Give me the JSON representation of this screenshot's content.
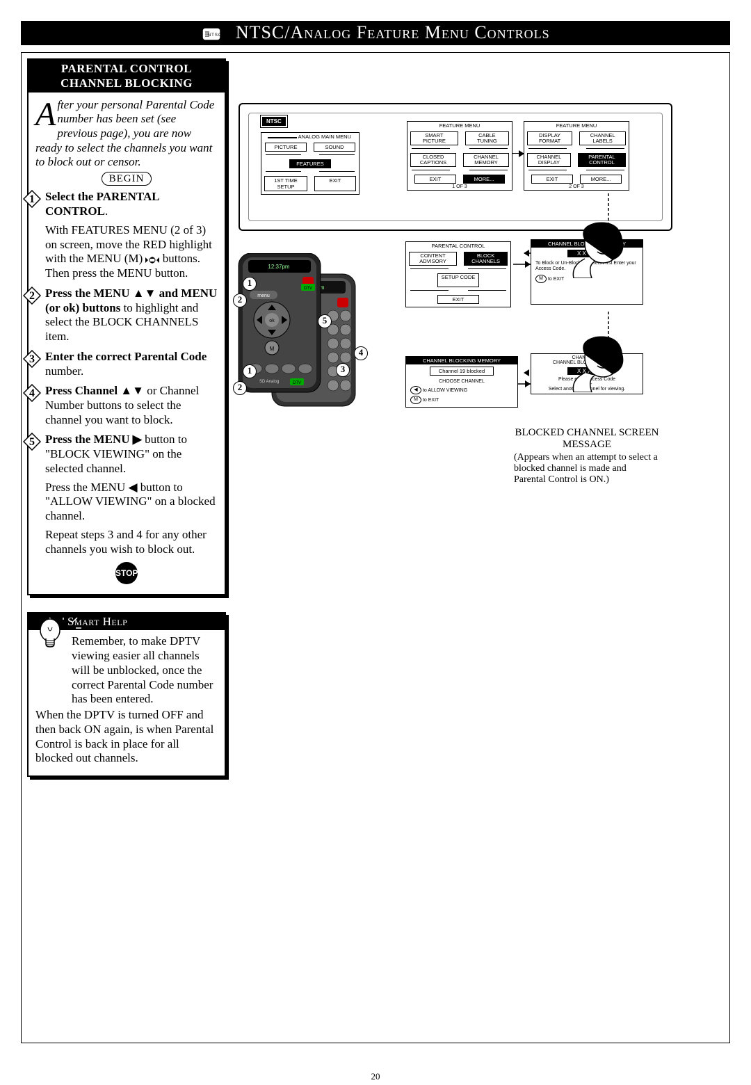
{
  "page_title": "NTSC/Analog Feature Menu Controls",
  "page_number": "20",
  "parental_card": {
    "heading_line1": "PARENTAL CONTROL",
    "heading_line2": "CHANNEL BLOCKING",
    "intro_dropcap": "A",
    "intro_rest": "fter your personal Parental Code number has been set (see previous page), you are now ready to select the channels you want to block out or censor.",
    "begin_label": "BEGIN",
    "step1_bold": "Select the PARENTAL CONTROL",
    "step1_after": ".",
    "step1_detail": "With FEATURES MENU (2 of 3) on screen, move the RED highlight with the MENU (M) ",
    "step1_detail_after": " buttons. Then press the MENU button.",
    "step2_bold": "Press the MENU ▲▼ and MENU (or ok) buttons",
    "step2_rest": " to highlight and select the BLOCK CHANNELS item.",
    "step3_bold": "Enter the correct Parental Code",
    "step3_rest": " number.",
    "step4_bold": "Press Channel ▲▼",
    "step4_rest": " or Channel Number buttons to select the channel you want to block.",
    "step5_bold": "Press the MENU ▶",
    "step5_rest": " button to \"BLOCK VIEWING\" on the selected channel.",
    "step5_line2a": "Press the MENU ◀ button to \"ALLOW VIEWING\" on a blocked channel.",
    "step5_line3": "Repeat steps 3 and 4 for any other channels you wish to block out.",
    "stop_label": "STOP"
  },
  "smart_help": {
    "heading": "Smart Help",
    "para1": "Remember, to make DPTV viewing easier all channels will be unblocked, once the correct Parental Code number has been entered.",
    "para2": "When the DPTV is turned OFF and then back ON again, is when Parental Control is back in place for all blocked out channels."
  },
  "diagram": {
    "ntsc_label": "NTSC",
    "analog_menu": {
      "title": "ANALOG MAIN MENU",
      "btn1": "PICTURE",
      "btn2": "SOUND",
      "btn3": "FEATURES",
      "btn4": "1ST TIME SETUP",
      "btn5": "EXIT"
    },
    "feature_menu_1": {
      "title": "FEATURE MENU",
      "btn1": "SMART PICTURE",
      "btn2": "CABLE TUNING",
      "btn3": "CLOSED CAPTIONS",
      "btn4": "CHANNEL MEMORY",
      "btn5": "EXIT",
      "btn6": "MORE...",
      "footer": "1 OF 3"
    },
    "feature_menu_2": {
      "title": "FEATURE MENU",
      "btn1": "DISPLAY FORMAT",
      "btn2": "CHANNEL LABELS",
      "btn3": "CHANNEL DISPLAY",
      "btn4": "PARENTAL CONTROL",
      "btn5": "EXIT",
      "btn6": "MORE...",
      "footer": "2 OF 3"
    },
    "parental_menu": {
      "title": "PARENTAL CONTROL",
      "btn1": "CONTENT ADVISORY",
      "btn2": "BLOCK CHANNELS",
      "btn3": "SETUP CODE",
      "btn4": "EXIT"
    },
    "cbm1": {
      "title": "CHANNEL BLOCKING MEMORY",
      "code": "X  X  X  X",
      "note": "To Block or Un-Block channels First Enter your Access Code.",
      "exit_key": "M",
      "exit_label": "to EXIT"
    },
    "cbm2": {
      "title": "CHANNEL BLOCKING MEMORY",
      "status": "Channel 19 blocked",
      "choose": "CHOOSE CHANNEL",
      "allow_key": "◀",
      "allow_label": "to ALLOW VIEWING",
      "exit_key": "M",
      "exit_label": "to EXIT"
    },
    "blocked_screen": {
      "title1": "CHANNEL 19",
      "title2": "CHANNEL BLOCKING ACTIVE",
      "code": "X  X  X  X",
      "note1": "Please enter Access Code",
      "note_or": "-OR-",
      "note2": "Select another Channel for viewing."
    },
    "caption_title": "BLOCKED CHANNEL SCREEN MESSAGE",
    "caption_sub": "(Appears when an attempt to select a blocked channel is made and Parental Control is ON.)"
  }
}
